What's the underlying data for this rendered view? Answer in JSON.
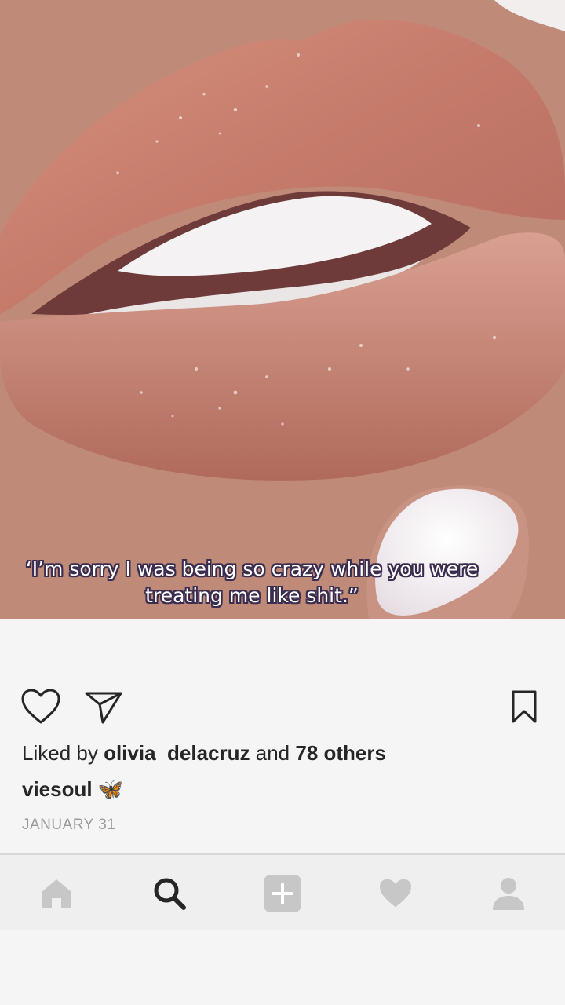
{
  "post": {
    "caption_lines": [
      "‘I’m sorry I was being so crazy while you were",
      "treating me like shit.”"
    ],
    "liked_by_prefix": "Liked by",
    "liked_by_user": "olivia_delacruz",
    "liked_by_and": "and",
    "liked_by_others": "78 others",
    "owner": "viesoul 🦋",
    "date": "JANUARY 31"
  },
  "icons": {
    "like": "heart-outline-icon",
    "share": "paper-plane-icon",
    "save": "bookmark-icon"
  },
  "tabbar": {
    "tabs": [
      {
        "name": "home",
        "icon": "home-icon"
      },
      {
        "name": "search",
        "icon": "search-icon",
        "active": true
      },
      {
        "name": "add",
        "icon": "plus-square-icon"
      },
      {
        "name": "activity",
        "icon": "heart-filled-icon"
      },
      {
        "name": "profile",
        "icon": "person-icon"
      }
    ]
  },
  "colors": {
    "background": "#f5f5f5",
    "text": "#262626",
    "muted": "#9a9a9a",
    "tab_inactive": "#c7c7c7",
    "tab_active": "#262626"
  }
}
